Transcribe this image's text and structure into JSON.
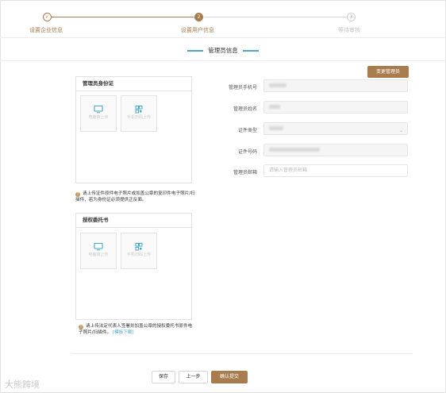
{
  "steps": [
    {
      "num": "✓",
      "label": "设置企业信息",
      "state": "done"
    },
    {
      "num": "2",
      "label": "设置用户信息",
      "state": "active"
    },
    {
      "num": "3",
      "label": "等待审核",
      "state": "todo"
    }
  ],
  "section_title": "管理员信息",
  "id_box": {
    "title": "管理员身份证",
    "tile_pc": "电脑端上传",
    "tile_mobile": "手机扫码上传",
    "note_icon": "!",
    "note": "请上传证件原件电子照片或加盖公章的复印件电子照片/扫描件，若为身份证必须提供正反面。"
  },
  "auth_box": {
    "title": "授权委托书",
    "tile_pc": "电脑端上传",
    "tile_mobile": "手机扫码上传",
    "note_icon": "!",
    "note": "请上传法定代表人签署并加盖公章的授权委托书原件电子照片/扫描件。",
    "template_link": "[模板下载]"
  },
  "change_admin_label": "变更管理员",
  "form": {
    "phone_label": "管理员手机号",
    "name_label": "管理员姓名",
    "id_type_label": "证件类型",
    "id_number_label": "证件号码",
    "email_label": "管理员邮箱",
    "email_placeholder": "请输入管理员邮箱"
  },
  "footer": {
    "save_label": "保存",
    "prev_label": "上一步",
    "submit_label": "确认提交"
  },
  "watermark": "大熊跨境",
  "colors": {
    "accent": "#a87c4f",
    "link": "#4aa8c5"
  }
}
